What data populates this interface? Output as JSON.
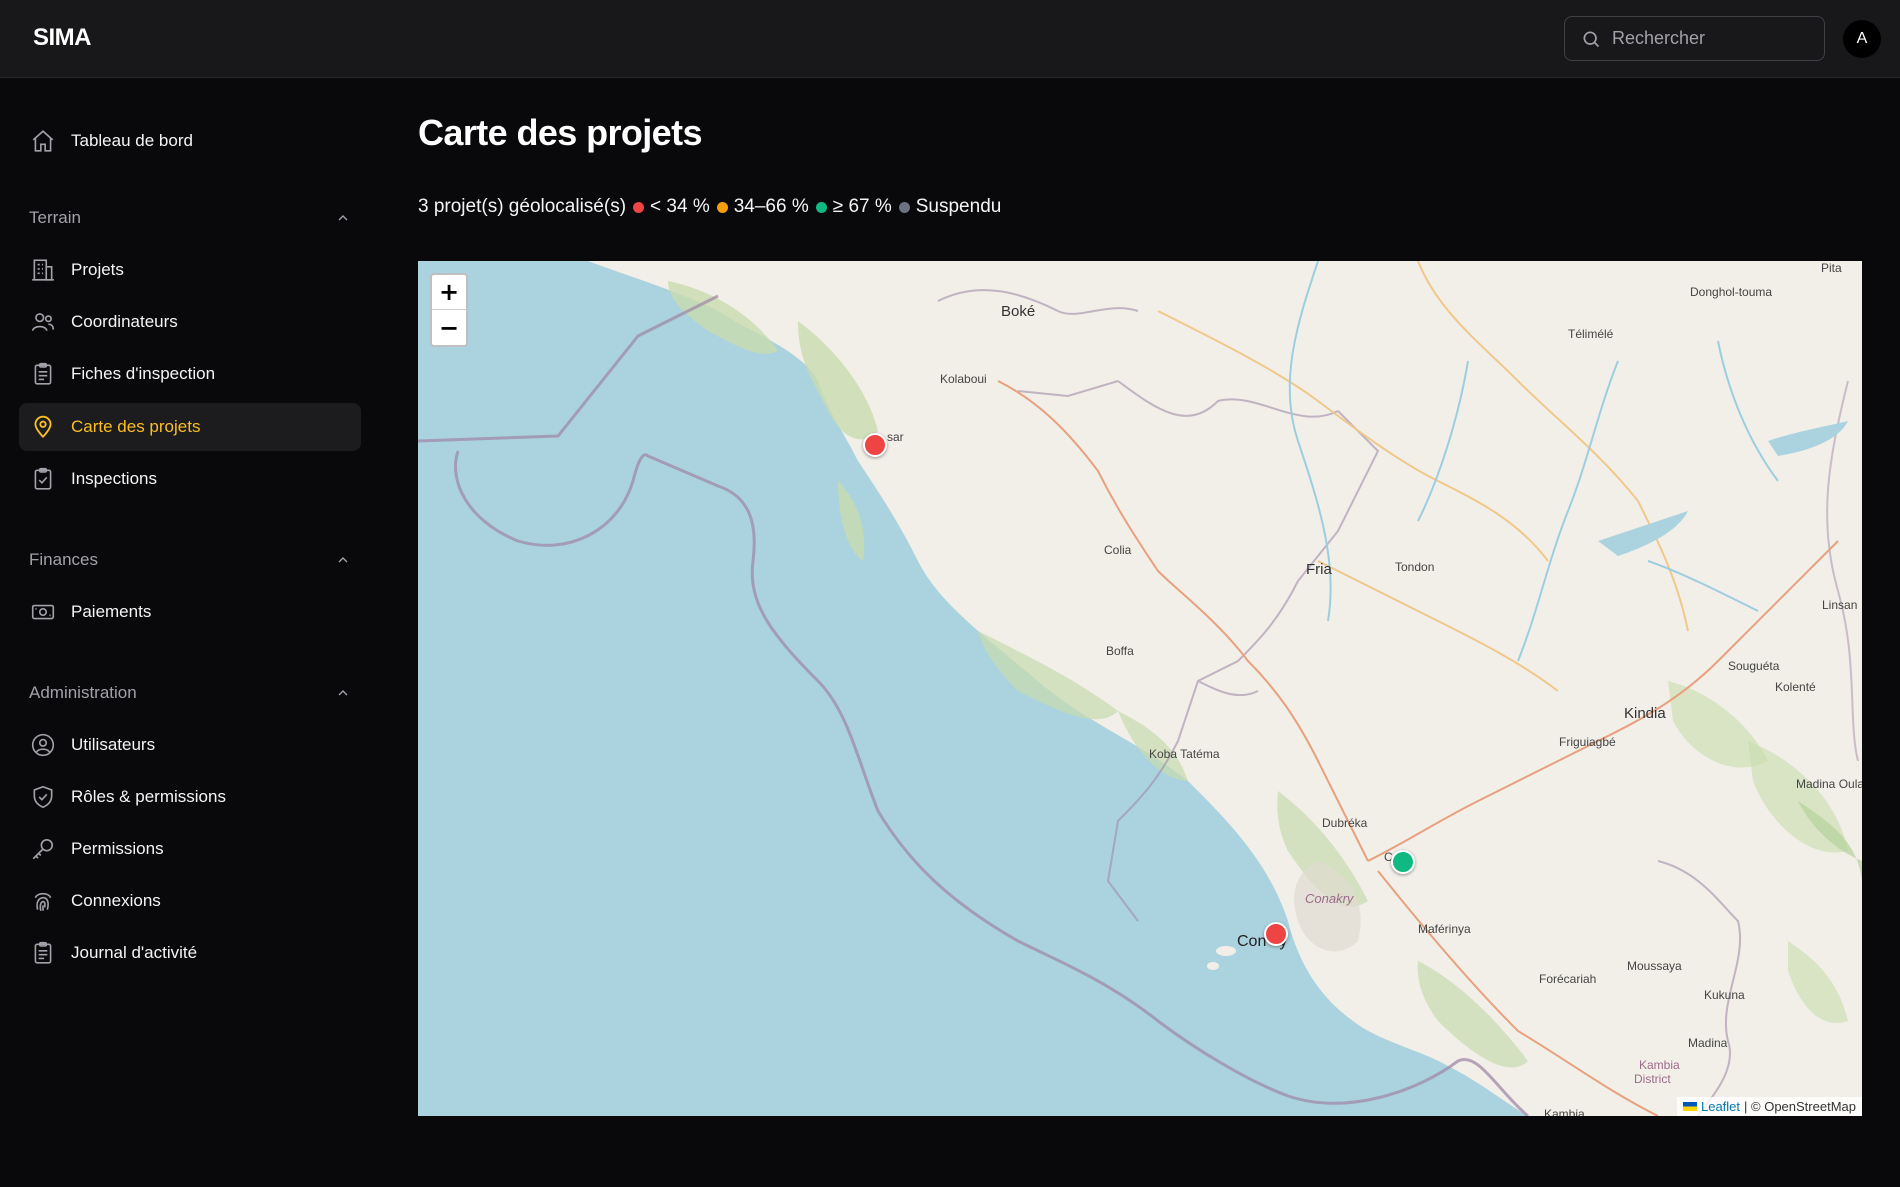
{
  "app": {
    "brand": "SIMA"
  },
  "header": {
    "search_placeholder": "Rechercher",
    "avatar_initial": "A"
  },
  "sidebar": {
    "dashboard": "Tableau de bord",
    "sections": {
      "terrain": "Terrain",
      "finances": "Finances",
      "administration": "Administration"
    },
    "items": {
      "projets": "Projets",
      "coordinateurs": "Coordinateurs",
      "fiches": "Fiches d'inspection",
      "carte": "Carte des projets",
      "inspections": "Inspections",
      "paiements": "Paiements",
      "utilisateurs": "Utilisateurs",
      "roles": "Rôles & permissions",
      "permissions": "Permissions",
      "connexions": "Connexions",
      "journal": "Journal d'activité"
    }
  },
  "main": {
    "title": "Carte des projets",
    "count_text": "3 projet(s) géolocalisé(s)",
    "legend": [
      {
        "label": "< 34 %",
        "color": "#ef4444"
      },
      {
        "label": "34–66 %",
        "color": "#f59e0b"
      },
      {
        "label": "≥ 67 %",
        "color": "#10b981"
      },
      {
        "label": "Suspendu",
        "color": "#6b7280"
      }
    ]
  },
  "map": {
    "zoom_in": "+",
    "zoom_out": "−",
    "attribution_link": "Leaflet",
    "attribution_text": "| © OpenStreetMap",
    "places": {
      "boke": "Boké",
      "telimele": "Télimélé",
      "donghol": "Donghol-touma",
      "pita": "Pita",
      "kolaboui": "Kolaboui",
      "kamsar": "sar",
      "colia": "Colia",
      "fria": "Fria",
      "tondon": "Tondon",
      "linsan": "Linsan",
      "boffa": "Boffa",
      "souguta": "Souguéta",
      "kolente": "Kolenté",
      "kindia": "Kindia",
      "friguiagbe": "Friguiagbé",
      "madina_oula": "Madina Oula",
      "koba": "Koba Tatéma",
      "dubreka": "Dubréka",
      "conakry_region": "Conakry",
      "coyah": "C",
      "maferinya": "Maférinya",
      "conakry": "Con",
      "conakry_tail": "ry",
      "forecariah": "Forécariah",
      "moussaya": "Moussaya",
      "kukuna": "Kukuna",
      "madina": "Madina",
      "kambia_district": "Kambia",
      "kambia_district2": "District",
      "kambia": "Kambia"
    },
    "markers": [
      {
        "status": "< 34 %",
        "color": "#ef4444"
      },
      {
        "status": "≥ 67 %",
        "color": "#10b981"
      },
      {
        "status": "< 34 %",
        "color": "#ef4444"
      }
    ]
  }
}
